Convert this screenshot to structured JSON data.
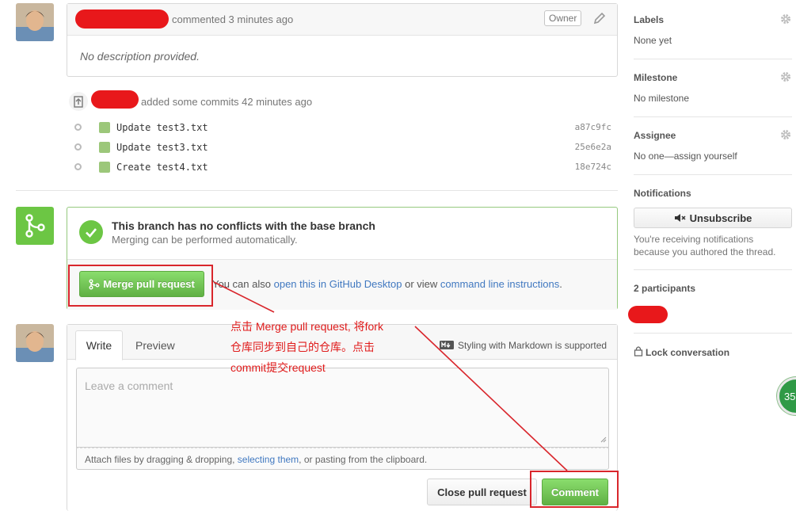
{
  "comment": {
    "meta": "commented 3 minutes ago",
    "owner_badge": "Owner",
    "body": "No description provided."
  },
  "commits": {
    "header": "added some commits 42 minutes ago",
    "items": [
      {
        "message": "Update test3.txt",
        "sha": "a87c9fc"
      },
      {
        "message": "Update test3.txt",
        "sha": "25e6e2a"
      },
      {
        "message": "Create test4.txt",
        "sha": "18e724c"
      }
    ]
  },
  "merge": {
    "title": "This branch has no conflicts with the base branch",
    "subtitle": "Merging can be performed automatically.",
    "button": "Merge pull request",
    "also_prefix": "You can also",
    "desktop_link": "open this in GitHub Desktop",
    "or_view": "or view",
    "cli_link": "command line instructions",
    "period": "."
  },
  "annotation": {
    "line1": "点击 Merge pull request, 将fork",
    "line2": "仓库同步到自己的仓库。点击",
    "line3": "commit提交request"
  },
  "editor": {
    "tab_write": "Write",
    "tab_preview": "Preview",
    "markdown_hint": "Styling with Markdown is supported",
    "placeholder": "Leave a comment",
    "attach_prefix": "Attach files by dragging & dropping,",
    "attach_link": "selecting them",
    "attach_suffix": ", or pasting from the clipboard.",
    "close_button": "Close pull request",
    "comment_button": "Comment"
  },
  "sidebar": {
    "labels_title": "Labels",
    "labels_value": "None yet",
    "milestone_title": "Milestone",
    "milestone_value": "No milestone",
    "assignee_title": "Assignee",
    "assignee_value": "No one—assign yourself",
    "notifications_title": "Notifications",
    "unsubscribe_button": "Unsubscribe",
    "notifications_note_1": "You're receiving notifications",
    "notifications_note_2": "because you authored the thread.",
    "participants_title": "2 participants",
    "lock_label": "Lock conversation",
    "floating_badge": "35"
  },
  "colors": {
    "merge_green": "#6cc644",
    "button_green": "#60b044",
    "link_blue": "#4078c0",
    "annotation_red": "#e01b1b",
    "redaction_red": "#e8181b"
  }
}
